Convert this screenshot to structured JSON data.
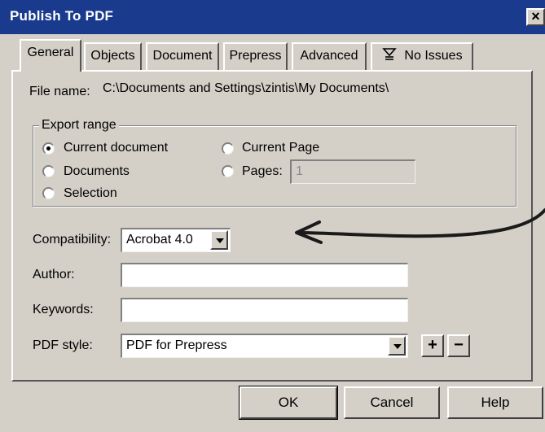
{
  "window": {
    "title": "Publish To PDF",
    "close_label": "×"
  },
  "tabs": [
    {
      "label": "General",
      "active": true
    },
    {
      "label": "Objects"
    },
    {
      "label": "Document"
    },
    {
      "label": "Prepress"
    },
    {
      "label": "Advanced"
    },
    {
      "label": "No Issues",
      "icon": "issues-icon"
    }
  ],
  "file": {
    "label": "File name:",
    "value": "C:\\Documents and Settings\\zintis\\My Documents\\"
  },
  "export_range": {
    "legend": "Export range",
    "options": [
      {
        "label": "Current document",
        "checked": true
      },
      {
        "label": "Documents",
        "checked": false
      },
      {
        "label": "Selection",
        "checked": false
      },
      {
        "label": "Current Page",
        "checked": false
      },
      {
        "label": "Pages:",
        "checked": false
      }
    ],
    "pages_value": "1"
  },
  "compatibility": {
    "label": "Compatibility:",
    "value": "Acrobat 4.0"
  },
  "author": {
    "label": "Author:",
    "value": ""
  },
  "keywords": {
    "label": "Keywords:",
    "value": ""
  },
  "pdf_style": {
    "label": "PDF style:",
    "value": "PDF for Prepress",
    "add_label": "+",
    "remove_label": "−"
  },
  "buttons": {
    "ok": "OK",
    "cancel": "Cancel",
    "help": "Help"
  },
  "annotation": {
    "type": "hand-drawn-arrow",
    "color": "#1a1a1a"
  }
}
